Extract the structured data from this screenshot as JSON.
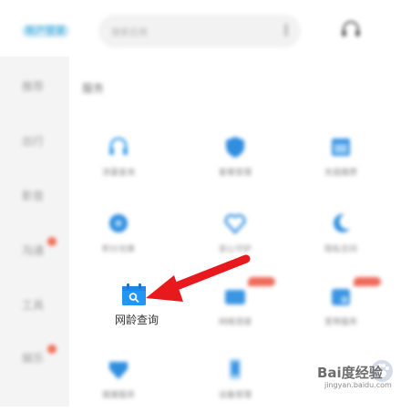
{
  "header": {
    "brand": "账户管家",
    "search_placeholder": "搜索应用",
    "service_icon": "headset-icon"
  },
  "sidebar": {
    "items": [
      {
        "label": "推荐"
      },
      {
        "label": "出行"
      },
      {
        "label": "影音"
      },
      {
        "label": "沟通"
      },
      {
        "label": "工具"
      },
      {
        "label": "娱乐"
      }
    ]
  },
  "main": {
    "section_title": "服务",
    "tiles": [
      {
        "label": "流量查询",
        "icon": "headset-icon"
      },
      {
        "label": "套餐管理",
        "icon": "shield-icon"
      },
      {
        "label": "充值缴费",
        "icon": "calendar-icon"
      },
      {
        "label": "积分兑换",
        "icon": "gear-icon"
      },
      {
        "label": "安心守护",
        "icon": "heart-icon"
      },
      {
        "label": "隐私空间",
        "icon": "moon-icon"
      },
      {
        "label": "网络测速",
        "icon": "wifi-icon"
      },
      {
        "label": "宽带服务",
        "icon": "cloud-icon"
      },
      {
        "label": "健康服务",
        "icon": "heart-icon"
      },
      {
        "label": "设备管理",
        "icon": "phone-icon"
      }
    ]
  },
  "focus": {
    "label": "网龄查询",
    "icon": "calendar-search-icon"
  },
  "watermark": {
    "text": "Bai度经验",
    "sub": "jingyan.baidu.com"
  },
  "colors": {
    "accent": "#2196f3",
    "arrow": "#e8191d",
    "badge": "#ef6a5a"
  }
}
